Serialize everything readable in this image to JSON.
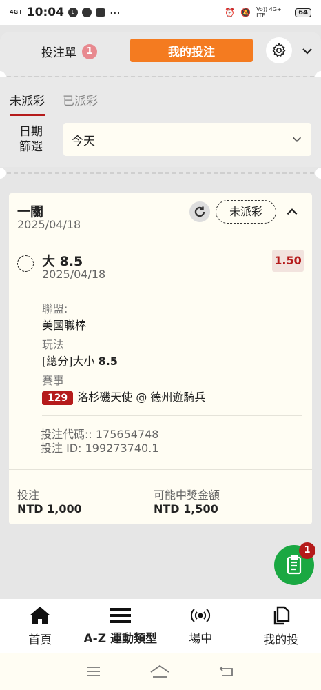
{
  "status_bar": {
    "network": "4G+",
    "time": "10:04",
    "volte": "Vo)) 4G+ LTE",
    "battery": "64"
  },
  "header": {
    "slip_label": "投注單",
    "slip_count": "1",
    "my_bets_label": "我的投注"
  },
  "filters": {
    "tab_unsettled": "未派彩",
    "tab_settled": "已派彩",
    "date_label": "日期篩選",
    "date_value": "今天"
  },
  "bet": {
    "type": "一關",
    "date": "2025/04/18",
    "status": "未派彩",
    "selection": "大 8.5",
    "selection_date": "2025/04/18",
    "odds": "1.50",
    "league_label": "聯盟:",
    "league": "美國職棒",
    "market_label": "玩法",
    "market_prefix": "[總分]大小 ",
    "market_line": "8.5",
    "event_label": "賽事",
    "event_id": "129",
    "event_name": "洛杉磯天使 @ 德州遊騎兵",
    "code_label": "投注代碼:: 175654748",
    "bet_id": "投注 ID: 199273740.1",
    "stake_label": "投注",
    "stake": "NTD 1,000",
    "payout_label": "可能中獎金額",
    "payout": "NTD 1,500"
  },
  "fab": {
    "badge": "1"
  },
  "bottom_nav": {
    "home": "首頁",
    "az": "A-Z 運動類型",
    "live": "場中",
    "mybets": "我的投"
  },
  "icons": {
    "home": "home-icon",
    "menu": "hamburger-icon",
    "live": "live-broadcast-icon",
    "bets": "documents-icon"
  },
  "colors": {
    "accent": "#f47b20",
    "red": "#b51b1b",
    "green": "#1aa842"
  }
}
